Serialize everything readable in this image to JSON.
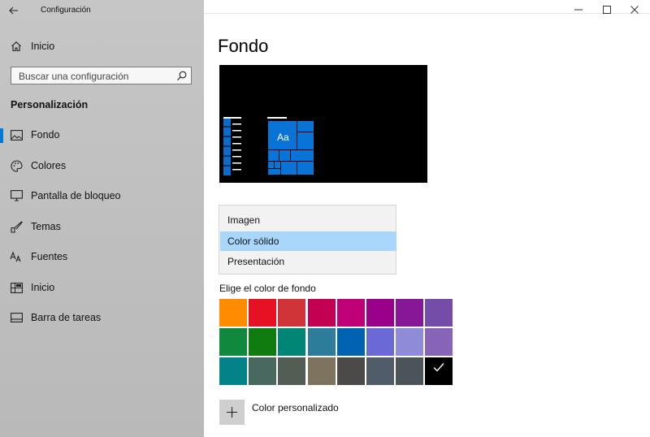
{
  "window": {
    "title": "Configuración",
    "back_icon": "arrow-left-icon",
    "controls": [
      "minimize-icon",
      "maximize-icon",
      "close-icon"
    ]
  },
  "sidebar": {
    "home": {
      "label": "Inicio",
      "icon": "home-icon"
    },
    "search": {
      "placeholder": "Buscar una configuración",
      "value": "",
      "icon": "search-icon"
    },
    "section": "Personalización",
    "items": [
      {
        "label": "Fondo",
        "icon": "picture-icon",
        "active": true
      },
      {
        "label": "Colores",
        "icon": "palette-icon",
        "active": false
      },
      {
        "label": "Pantalla de bloqueo",
        "icon": "monitor-icon",
        "active": false
      },
      {
        "label": "Temas",
        "icon": "brush-icon",
        "active": false
      },
      {
        "label": "Fuentes",
        "icon": "font-icon",
        "active": false
      },
      {
        "label": "Inicio",
        "icon": "start-layout-icon",
        "active": false
      },
      {
        "label": "Barra de tareas",
        "icon": "taskbar-icon",
        "active": false
      }
    ],
    "accent_color": "#0078d7"
  },
  "main": {
    "title": "Fondo",
    "preview": {
      "tile_text": "Aa",
      "background": "#000000",
      "accent": "#0078d7"
    },
    "background_dropdown": {
      "options": [
        "Imagen",
        "Color sólido",
        "Presentación"
      ],
      "selected": "Color sólido"
    },
    "color_section_label": "Elige el color de fondo",
    "colors": [
      [
        "#ff8c00",
        "#e81123",
        "#d13438",
        "#c30052",
        "#bf0077",
        "#9a0089",
        "#881798",
        "#744da9"
      ],
      [
        "#10893e",
        "#107c10",
        "#018574",
        "#2d7d9a",
        "#0063b1",
        "#6b69d6",
        "#8e8cd8",
        "#8764b8"
      ],
      [
        "#038387",
        "#486860",
        "#525e54",
        "#7e735f",
        "#4c4a48",
        "#515c6b",
        "#4a5459",
        "#000000"
      ]
    ],
    "selected_color": "#000000",
    "custom_color": {
      "label": "Color personalizado",
      "icon": "plus-icon"
    }
  }
}
